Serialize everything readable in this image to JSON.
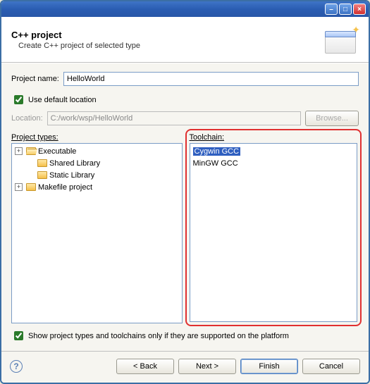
{
  "header": {
    "title": "C++ project",
    "subtitle": "Create C++ project of selected type"
  },
  "fields": {
    "project_name_label": "Project name:",
    "project_name_value": "HelloWorld",
    "use_default_location_label": "Use default location",
    "use_default_location_checked": true,
    "location_label": "Location:",
    "location_value": "C:/work/wsp/HelloWorld",
    "browse_label": "Browse..."
  },
  "panels": {
    "project_types_label": "Project types:",
    "toolchain_label": "Toolchain:"
  },
  "project_types": [
    {
      "label": "Executable",
      "expandable": true,
      "indent": 0,
      "open": true
    },
    {
      "label": "Shared Library",
      "expandable": false,
      "indent": 1,
      "open": false
    },
    {
      "label": "Static Library",
      "expandable": false,
      "indent": 1,
      "open": false
    },
    {
      "label": "Makefile project",
      "expandable": true,
      "indent": 0,
      "open": false
    }
  ],
  "toolchains": [
    {
      "label": "Cygwin GCC",
      "selected": true
    },
    {
      "label": "MinGW GCC",
      "selected": false
    }
  ],
  "show_supported_label": "Show project types and toolchains only if they are supported on the platform",
  "show_supported_checked": true,
  "footer": {
    "back": "< Back",
    "next": "Next >",
    "finish": "Finish",
    "cancel": "Cancel"
  }
}
